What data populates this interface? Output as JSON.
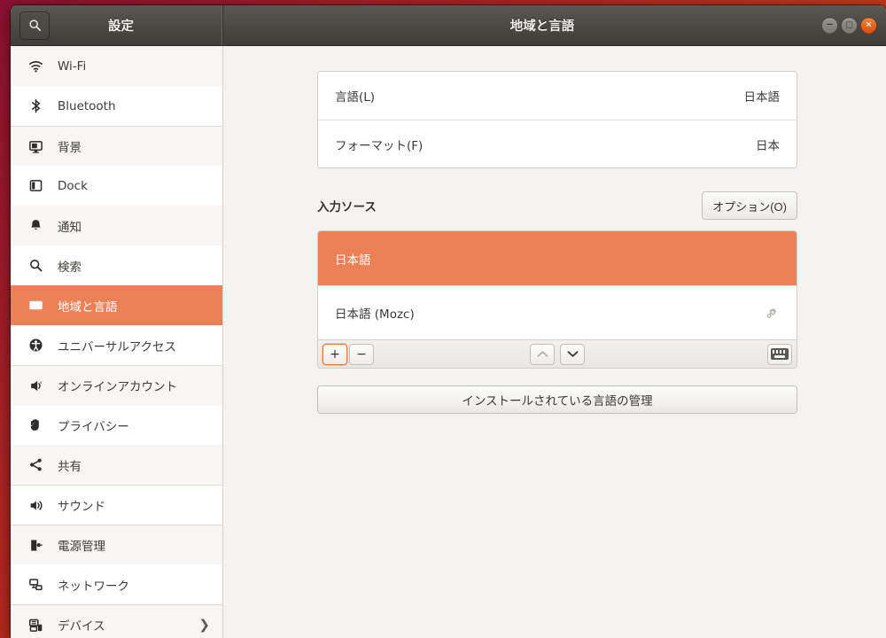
{
  "window": {
    "app_title": "設定",
    "page_title": "地域と言語",
    "search_icon": "search-icon",
    "controls": {
      "minimize": "−",
      "maximize": "□",
      "close": "×",
      "close_color": "#e05a1c"
    }
  },
  "theme": {
    "accent": "#ec8157",
    "sidebar_bg": "#ffffff",
    "sidebar_alt_bg": "#f7f6f5",
    "main_bg": "#f4f3f2",
    "titlebar_bg": "#4b4743"
  },
  "sidebar": {
    "items": [
      {
        "label": "Wi-Fi",
        "icon": "wifi-icon",
        "selected": false,
        "alt": true,
        "sep": false,
        "chevron": false
      },
      {
        "label": "Bluetooth",
        "icon": "bluetooth-icon",
        "selected": false,
        "alt": false,
        "sep": false,
        "chevron": false
      },
      {
        "label": "背景",
        "icon": "monitor-wallpaper-icon",
        "selected": false,
        "alt": true,
        "sep": true,
        "chevron": false
      },
      {
        "label": "Dock",
        "icon": "dock-icon",
        "selected": false,
        "alt": false,
        "sep": false,
        "chevron": false
      },
      {
        "label": "通知",
        "icon": "bell-icon",
        "selected": false,
        "alt": true,
        "sep": false,
        "chevron": false
      },
      {
        "label": "検索",
        "icon": "search-icon",
        "selected": false,
        "alt": false,
        "sep": false,
        "chevron": false
      },
      {
        "label": "地域と言語",
        "icon": "region-language-icon",
        "selected": true,
        "alt": false,
        "sep": false,
        "chevron": false
      },
      {
        "label": "ユニバーサルアクセス",
        "icon": "universal-access-icon",
        "selected": false,
        "alt": false,
        "sep": false,
        "chevron": false
      },
      {
        "label": "オンラインアカウント",
        "icon": "online-accounts-icon",
        "selected": false,
        "alt": true,
        "sep": true,
        "chevron": false
      },
      {
        "label": "プライバシー",
        "icon": "privacy-hand-icon",
        "selected": false,
        "alt": false,
        "sep": false,
        "chevron": false
      },
      {
        "label": "共有",
        "icon": "sharing-icon",
        "selected": false,
        "alt": true,
        "sep": false,
        "chevron": false
      },
      {
        "label": "サウンド",
        "icon": "sound-icon",
        "selected": false,
        "alt": false,
        "sep": true,
        "chevron": false
      },
      {
        "label": "電源管理",
        "icon": "power-icon",
        "selected": false,
        "alt": true,
        "sep": true,
        "chevron": false
      },
      {
        "label": "ネットワーク",
        "icon": "network-icon",
        "selected": false,
        "alt": false,
        "sep": false,
        "chevron": false
      },
      {
        "label": "デバイス",
        "icon": "devices-icon",
        "selected": false,
        "alt": true,
        "sep": true,
        "chevron": true
      }
    ]
  },
  "main": {
    "language_rows": [
      {
        "label": "言語(L)",
        "value": "日本語"
      },
      {
        "label": "フォーマット(F)",
        "value": "日本"
      }
    ],
    "input_sources": {
      "section_title": "入力ソース",
      "options_button": "オプション(O)",
      "rows": [
        {
          "label": "日本語",
          "selected": true,
          "gear": false
        },
        {
          "label": "日本語 (Mozc)",
          "selected": false,
          "gear": true
        }
      ],
      "toolbar": {
        "add": "+",
        "remove": "−",
        "move_up": "⌃",
        "move_down": "⌄",
        "keyboard_icon": "keyboard-icon",
        "add_focused": true,
        "move_up_enabled": false,
        "move_down_enabled": true
      }
    },
    "manage_button": "インストールされている言語の管理"
  }
}
